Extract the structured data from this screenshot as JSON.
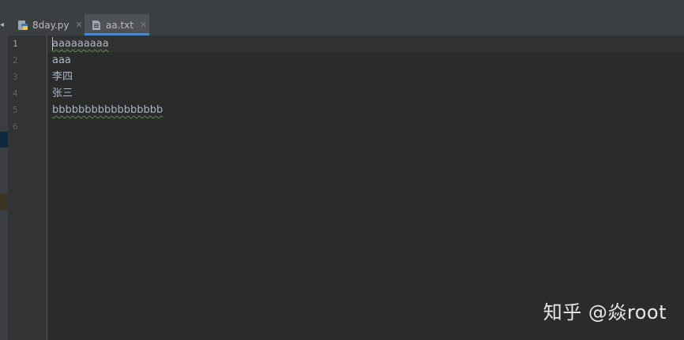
{
  "tabs": [
    {
      "label": "8day.py",
      "icon": "python-file-icon",
      "active": false
    },
    {
      "label": "aa.txt",
      "icon": "text-file-icon",
      "active": true
    }
  ],
  "close_glyph": "✕",
  "line_numbers": [
    "1",
    "2",
    "3",
    "4",
    "5",
    "6"
  ],
  "lines": [
    "aaaaaaaaa",
    "aaa",
    "李四",
    "张三",
    "bbbbbbbbbbbbbbbbb",
    ""
  ],
  "watermark": "知乎 @焱root",
  "colors": {
    "editor_bg": "#2b2b2b",
    "gutter_bg": "#313335",
    "tab_active_underline": "#4a88c7",
    "text": "#a9b7c6"
  }
}
